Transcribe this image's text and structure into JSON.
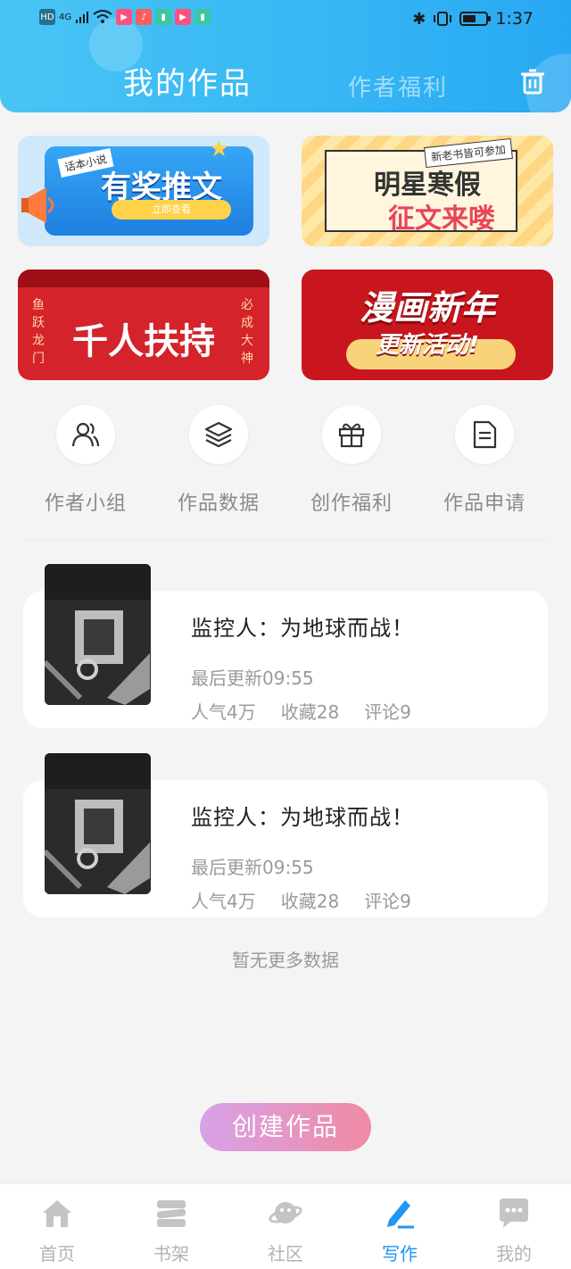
{
  "status_bar": {
    "left_label": "HD",
    "network": "4G",
    "time": "1:37"
  },
  "header": {
    "tab_mine": "我的作品",
    "tab_welfare": "作者福利",
    "trash_icon": "trash-icon"
  },
  "banners": [
    {
      "title": "有奖推文",
      "subtitle": "立即查看",
      "tag": "话本小说"
    },
    {
      "title_line1": "明星寒假",
      "title_line2": "征文来喽",
      "tag": "新老书皆可参加"
    },
    {
      "title": "千人扶持",
      "left_tag": "鱼跃龙门",
      "right_tag": "必成大神"
    },
    {
      "title_line1": "漫画新年",
      "title_line2": "更新活动!"
    }
  ],
  "menu": [
    {
      "label": "作者小组",
      "icon": "users-icon"
    },
    {
      "label": "作品数据",
      "icon": "layers-icon"
    },
    {
      "label": "创作福利",
      "icon": "gift-icon"
    },
    {
      "label": "作品申请",
      "icon": "document-icon"
    }
  ],
  "works": [
    {
      "title": "监控人：为地球而战！",
      "updated": "最后更新09:55",
      "popularity": "人气4万",
      "favorites": "收藏28",
      "comments": "评论9"
    },
    {
      "title": "监控人：为地球而战！",
      "updated": "最后更新09:55",
      "popularity": "人气4万",
      "favorites": "收藏28",
      "comments": "评论9"
    }
  ],
  "no_more": "暂无更多数据",
  "create_button": "创建作品",
  "nav": [
    {
      "label": "首页",
      "icon": "home-icon"
    },
    {
      "label": "书架",
      "icon": "bookshelf-icon"
    },
    {
      "label": "社区",
      "icon": "planet-icon"
    },
    {
      "label": "写作",
      "icon": "pen-icon",
      "active": true
    },
    {
      "label": "我的",
      "icon": "chat-icon"
    }
  ],
  "colors": {
    "header": "#36b6f4",
    "active_nav": "#2196f3",
    "create_button_start": "#d8a2e8",
    "create_button_end": "#f08aa4"
  }
}
